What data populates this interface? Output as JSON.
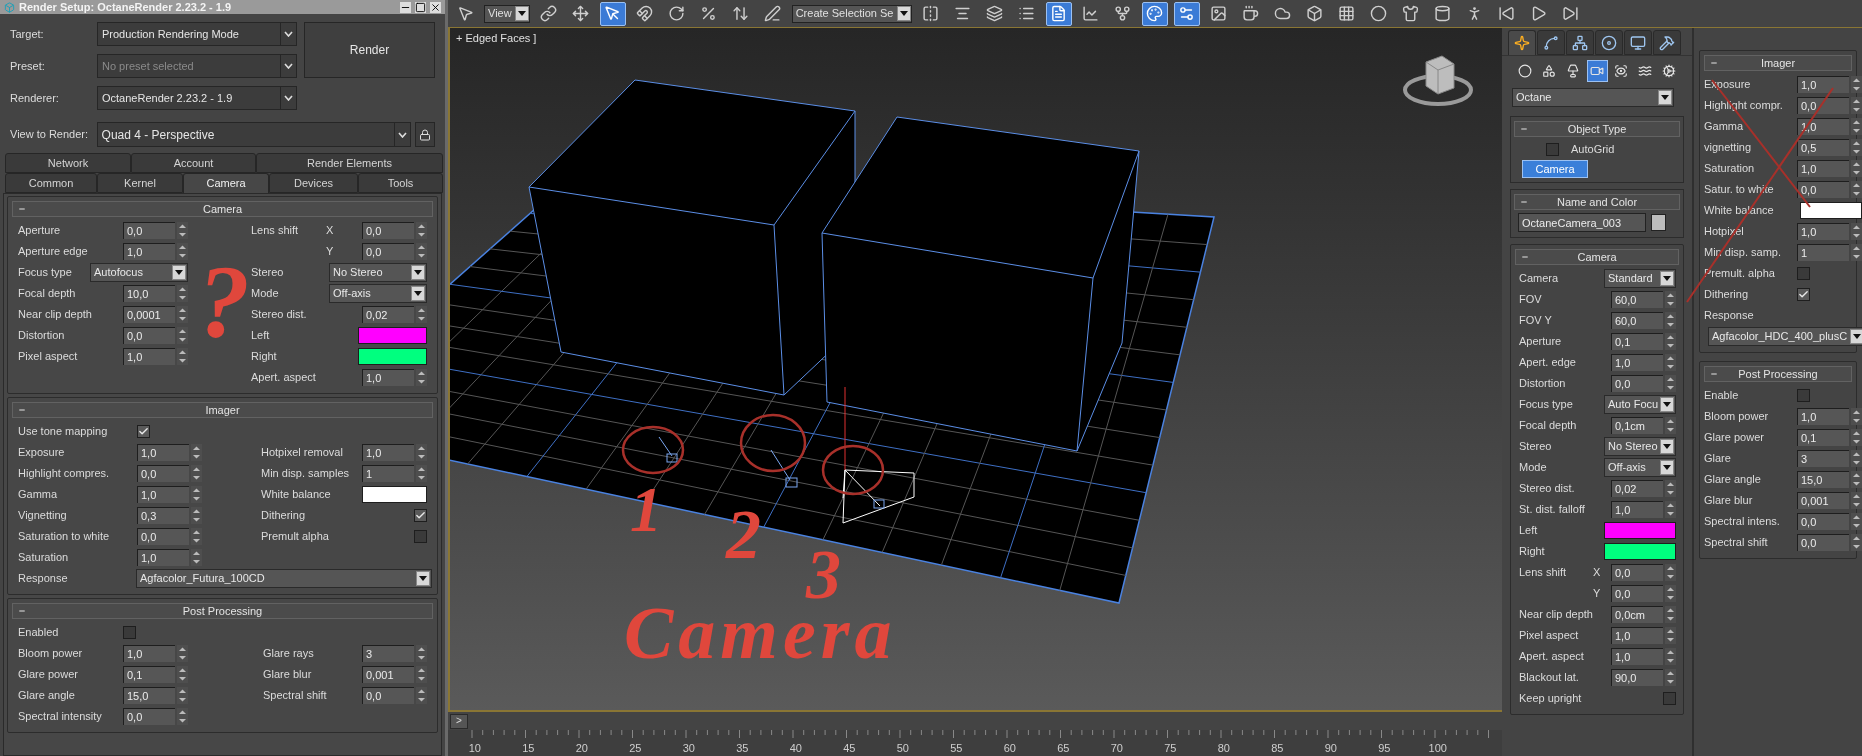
{
  "render_setup": {
    "title": "Render Setup: OctaneRender 2.23.2 - 1.9",
    "fields": [
      {
        "label": "Target:",
        "value": "Production Rendering Mode",
        "disabled": false
      },
      {
        "label": "Preset:",
        "value": "No preset selected",
        "disabled": true
      },
      {
        "label": "Renderer:",
        "value": "OctaneRender 2.23.2 - 1.9",
        "disabled": false
      }
    ],
    "render_button": "Render",
    "view_to_render": {
      "label": "View to Render:",
      "value": "Quad 4 - Perspective"
    },
    "tabs_row1": [
      {
        "label": "Network",
        "selected": false
      },
      {
        "label": "Account",
        "selected": false
      },
      {
        "label": "Render Elements",
        "selected": false
      }
    ],
    "tabs_row2": [
      {
        "label": "Common",
        "selected": false
      },
      {
        "label": "Kernel",
        "selected": false
      },
      {
        "label": "Camera",
        "selected": true
      },
      {
        "label": "Devices",
        "selected": false
      },
      {
        "label": "Tools",
        "selected": false
      }
    ],
    "rollouts": [
      {
        "title": "Camera",
        "sections": [
          {
            "columns": [
              [
                {
                  "kind": "spinner",
                  "label": "Aperture",
                  "value": "0,0"
                },
                {
                  "kind": "spinner",
                  "label": "Aperture edge",
                  "value": "1,0"
                },
                {
                  "kind": "dropdown",
                  "label": "Focus type",
                  "value": "Autofocus"
                },
                {
                  "kind": "spinner",
                  "label": "Focal depth",
                  "value": "10,0"
                },
                {
                  "kind": "spinner",
                  "label": "Near clip depth",
                  "value": "0,0001"
                },
                {
                  "kind": "spinner",
                  "label": "Distortion",
                  "value": "0,0"
                },
                {
                  "kind": "spinner",
                  "label": "Pixel aspect",
                  "value": "1,0"
                }
              ],
              [
                {
                  "kind": "spinner",
                  "label": "Lens shift",
                  "axis": "X",
                  "value": "0,0"
                },
                {
                  "kind": "spinner",
                  "axis": "Y",
                  "value": "0,0"
                },
                {
                  "kind": "dropdown",
                  "label": "Stereo",
                  "value": "No Stereo"
                },
                {
                  "kind": "dropdown",
                  "label": "Mode",
                  "value": "Off-axis"
                },
                {
                  "kind": "spinner",
                  "label": "Stereo dist.",
                  "value": "0,02"
                },
                {
                  "kind": "color",
                  "label": "Left",
                  "color": "#ff00ff"
                },
                {
                  "kind": "color",
                  "label": "Right",
                  "color": "#00ff7f"
                },
                {
                  "kind": "spinner",
                  "label": "Apert. aspect",
                  "value": "1,0"
                }
              ]
            ]
          }
        ]
      },
      {
        "title": "Imager",
        "sections": [
          {
            "columns": [
              [
                {
                  "kind": "checkbox",
                  "label": "Use tone mapping",
                  "checked": true
                }
              ]
            ]
          },
          {
            "columns": [
              [
                {
                  "kind": "spinner",
                  "label": "Exposure",
                  "value": "1,0"
                },
                {
                  "kind": "spinner",
                  "label": "Highlight compres.",
                  "value": "0,0"
                },
                {
                  "kind": "spinner",
                  "label": "Gamma",
                  "value": "1,0"
                },
                {
                  "kind": "spinner",
                  "label": "Vignetting",
                  "value": "0,3"
                },
                {
                  "kind": "spinner",
                  "label": "Saturation to white",
                  "value": "0,0"
                },
                {
                  "kind": "spinner",
                  "label": "Saturation",
                  "value": "1,0"
                }
              ],
              [
                {
                  "kind": "spinner",
                  "label": "Hotpixel removal",
                  "value": "1,0"
                },
                {
                  "kind": "spinner",
                  "label": "Min disp. samples",
                  "value": "1"
                },
                {
                  "kind": "color",
                  "label": "White balance",
                  "color": "#ffffff"
                },
                {
                  "kind": "checkbox",
                  "label": "Dithering",
                  "checked": true
                },
                {
                  "kind": "checkbox",
                  "label": "Premult alpha",
                  "checked": false
                }
              ]
            ]
          },
          {
            "columns": [
              [
                {
                  "kind": "dropdown",
                  "label": "Response",
                  "value": "Agfacolor_Futura_100CD"
                }
              ]
            ]
          }
        ]
      },
      {
        "title": "Post Processing",
        "sections": [
          {
            "columns": [
              [
                {
                  "kind": "checkbox",
                  "label": "Enabled",
                  "checked": false
                }
              ]
            ]
          },
          {
            "columns": [
              [
                {
                  "kind": "spinner",
                  "label": "Bloom power",
                  "value": "1,0"
                },
                {
                  "kind": "spinner",
                  "label": "Glare power",
                  "value": "0,1"
                },
                {
                  "kind": "spinner",
                  "label": "Glare angle",
                  "value": "15,0"
                },
                {
                  "kind": "spinner",
                  "label": "Spectral intensity",
                  "value": "0,0"
                }
              ],
              [
                {
                  "kind": "spinner",
                  "label": "Glare rays",
                  "value": "3"
                },
                {
                  "kind": "spinner",
                  "label": "Glare blur",
                  "value": "0,001"
                },
                {
                  "kind": "spinner",
                  "label": "Spectral shift",
                  "value": "0,0"
                }
              ]
            ]
          }
        ]
      }
    ]
  },
  "toolbar": {
    "items": [
      {
        "kind": "button",
        "selected": false
      },
      {
        "kind": "dropdown",
        "value": "View"
      },
      {
        "kind": "button",
        "selected": false
      },
      {
        "kind": "button",
        "selected": false
      },
      {
        "kind": "button",
        "selected": true
      },
      {
        "kind": "button",
        "selected": false
      },
      {
        "kind": "button",
        "selected": false
      },
      {
        "kind": "button",
        "selected": false
      },
      {
        "kind": "button",
        "selected": false
      },
      {
        "kind": "button",
        "selected": false
      },
      {
        "kind": "dropdown",
        "value": "Create Selection Se"
      },
      {
        "kind": "button",
        "selected": false
      },
      {
        "kind": "button",
        "selected": false
      },
      {
        "kind": "button",
        "selected": false
      },
      {
        "kind": "button",
        "selected": false
      },
      {
        "kind": "button",
        "selected": true
      },
      {
        "kind": "button",
        "selected": false
      },
      {
        "kind": "button",
        "selected": false
      },
      {
        "kind": "button",
        "selected": true
      },
      {
        "kind": "button",
        "selected": true
      },
      {
        "kind": "button",
        "selected": false
      },
      {
        "kind": "button",
        "selected": false
      },
      {
        "kind": "button",
        "selected": false
      },
      {
        "kind": "button",
        "selected": false
      },
      {
        "kind": "button",
        "selected": false
      },
      {
        "kind": "button",
        "selected": false
      },
      {
        "kind": "button",
        "selected": false
      },
      {
        "kind": "button",
        "selected": false
      },
      {
        "kind": "button",
        "selected": false
      },
      {
        "kind": "button",
        "selected": false
      },
      {
        "kind": "button",
        "selected": false
      },
      {
        "kind": "button",
        "selected": false
      }
    ]
  },
  "viewport": {
    "label": "+ Edged Faces ]"
  },
  "timeline": {
    "button": ">",
    "level": 0,
    "ticks": [
      "10",
      "15",
      "20",
      "25",
      "30",
      "35",
      "40",
      "45",
      "50",
      "55",
      "60",
      "65",
      "70",
      "75",
      "80",
      "85",
      "90",
      "95",
      "100"
    ]
  },
  "command_panel": {
    "tabs": [
      {
        "selected": true
      },
      {
        "selected": false
      },
      {
        "selected": false
      },
      {
        "selected": false
      },
      {
        "selected": false
      },
      {
        "selected": false
      }
    ],
    "categories": [
      {
        "selected": false
      },
      {
        "selected": false
      },
      {
        "selected": false
      },
      {
        "selected": true
      },
      {
        "selected": false
      },
      {
        "selected": false
      },
      {
        "selected": false
      }
    ],
    "category_dropdown": "Octane",
    "object_type": {
      "title": "Object Type",
      "autogrid": {
        "label": "AutoGrid",
        "checked": false
      },
      "button": {
        "label": "Camera",
        "selected": true
      }
    },
    "name_and_color": {
      "title": "Name and Color",
      "name": "OctaneCamera_003",
      "color": "#bdbdbd"
    },
    "camera": {
      "title": "Camera",
      "sections": [
        {
          "columns": [
            [
              {
                "kind": "dropdown",
                "label": "Camera",
                "value": "Standard"
              },
              {
                "kind": "spinner",
                "label": "FOV",
                "value": "60,0"
              },
              {
                "kind": "spinner",
                "label": "FOV Y",
                "value": "60,0"
              },
              {
                "kind": "spinner",
                "label": "Aperture",
                "value": "0,1"
              },
              {
                "kind": "spinner",
                "label": "Apert. edge",
                "value": "1,0"
              },
              {
                "kind": "spinner",
                "label": "Distortion",
                "value": "0,0"
              },
              {
                "kind": "dropdown",
                "label": "Focus type",
                "value": "Auto Focu"
              },
              {
                "kind": "spinner",
                "label": "Focal depth",
                "value": "0,1cm"
              },
              {
                "kind": "dropdown",
                "label": "Stereo",
                "value": "No Stereo"
              },
              {
                "kind": "dropdown",
                "label": "Mode",
                "value": "Off-axis"
              },
              {
                "kind": "spinner",
                "label": "Stereo dist.",
                "value": "0,02"
              },
              {
                "kind": "spinner",
                "label": "St. dist. falloff",
                "value": "1,0"
              },
              {
                "kind": "color",
                "label": "Left",
                "color": "#ff00ff"
              },
              {
                "kind": "color",
                "label": "Right",
                "color": "#00ff7f"
              },
              {
                "kind": "spinner",
                "label": "Lens shift",
                "axis": "X",
                "value": "0,0"
              },
              {
                "kind": "spinner",
                "axis": "Y",
                "value": "0,0"
              },
              {
                "kind": "spinner",
                "label": "Near clip depth",
                "value": "0,0cm"
              },
              {
                "kind": "spinner",
                "label": "Pixel aspect",
                "value": "1,0"
              },
              {
                "kind": "spinner",
                "label": "Apert. aspect",
                "value": "1,0"
              },
              {
                "kind": "spinner",
                "label": "Blackout lat.",
                "value": "90,0"
              },
              {
                "kind": "checkbox",
                "label": "Keep upright",
                "checked": false
              }
            ]
          ]
        }
      ]
    }
  },
  "floating_panel": {
    "rollouts": [
      {
        "title": "Imager",
        "sections": [
          {
            "columns": [
              [
                {
                  "kind": "spinner",
                  "label": "Exposure",
                  "value": "1,0"
                },
                {
                  "kind": "spinner",
                  "label": "Highlight compr.",
                  "value": "0,0"
                },
                {
                  "kind": "spinner",
                  "label": "Gamma",
                  "value": "1,0"
                },
                {
                  "kind": "spinner",
                  "label": "vignetting",
                  "value": "0,5"
                },
                {
                  "kind": "spinner",
                  "label": "Saturation",
                  "value": "1,0"
                },
                {
                  "kind": "spinner",
                  "label": "Satur. to white",
                  "value": "0,0"
                },
                {
                  "kind": "color",
                  "label": "White balance",
                  "color": "#ffffff"
                },
                {
                  "kind": "spinner",
                  "label": "Hotpixel",
                  "value": "1,0"
                },
                {
                  "kind": "spinner",
                  "label": "Min disp. samp.",
                  "value": "1"
                },
                {
                  "kind": "checkbox",
                  "label": "Premult. alpha",
                  "checked": false
                },
                {
                  "kind": "checkbox",
                  "label": "Dithering",
                  "checked": true
                },
                {
                  "kind": "label",
                  "label": "Response"
                },
                {
                  "kind": "dropdown",
                  "value": "Agfacolor_HDC_400_plusC"
                }
              ]
            ]
          }
        ]
      },
      {
        "title": "Post Processing",
        "sections": [
          {
            "columns": [
              [
                {
                  "kind": "checkbox",
                  "label": "Enable",
                  "checked": false
                },
                {
                  "kind": "spinner",
                  "label": "Bloom power",
                  "value": "1,0"
                },
                {
                  "kind": "spinner",
                  "label": "Glare power",
                  "value": "0,1"
                },
                {
                  "kind": "spinner",
                  "label": "Glare",
                  "value": "3"
                },
                {
                  "kind": "spinner",
                  "label": "Glare angle",
                  "value": "15,0"
                },
                {
                  "kind": "spinner",
                  "label": "Glare blur",
                  "value": "0,001"
                },
                {
                  "kind": "spinner",
                  "label": "Spectral intens.",
                  "value": "0,0"
                },
                {
                  "kind": "spinner",
                  "label": "Spectral shift",
                  "value": "0,0"
                }
              ]
            ]
          }
        ]
      }
    ]
  },
  "handwritten_notes": [
    {
      "text": "?"
    },
    {
      "text": "1"
    },
    {
      "text": "2"
    },
    {
      "text": "3"
    },
    {
      "text": "Camera"
    }
  ]
}
